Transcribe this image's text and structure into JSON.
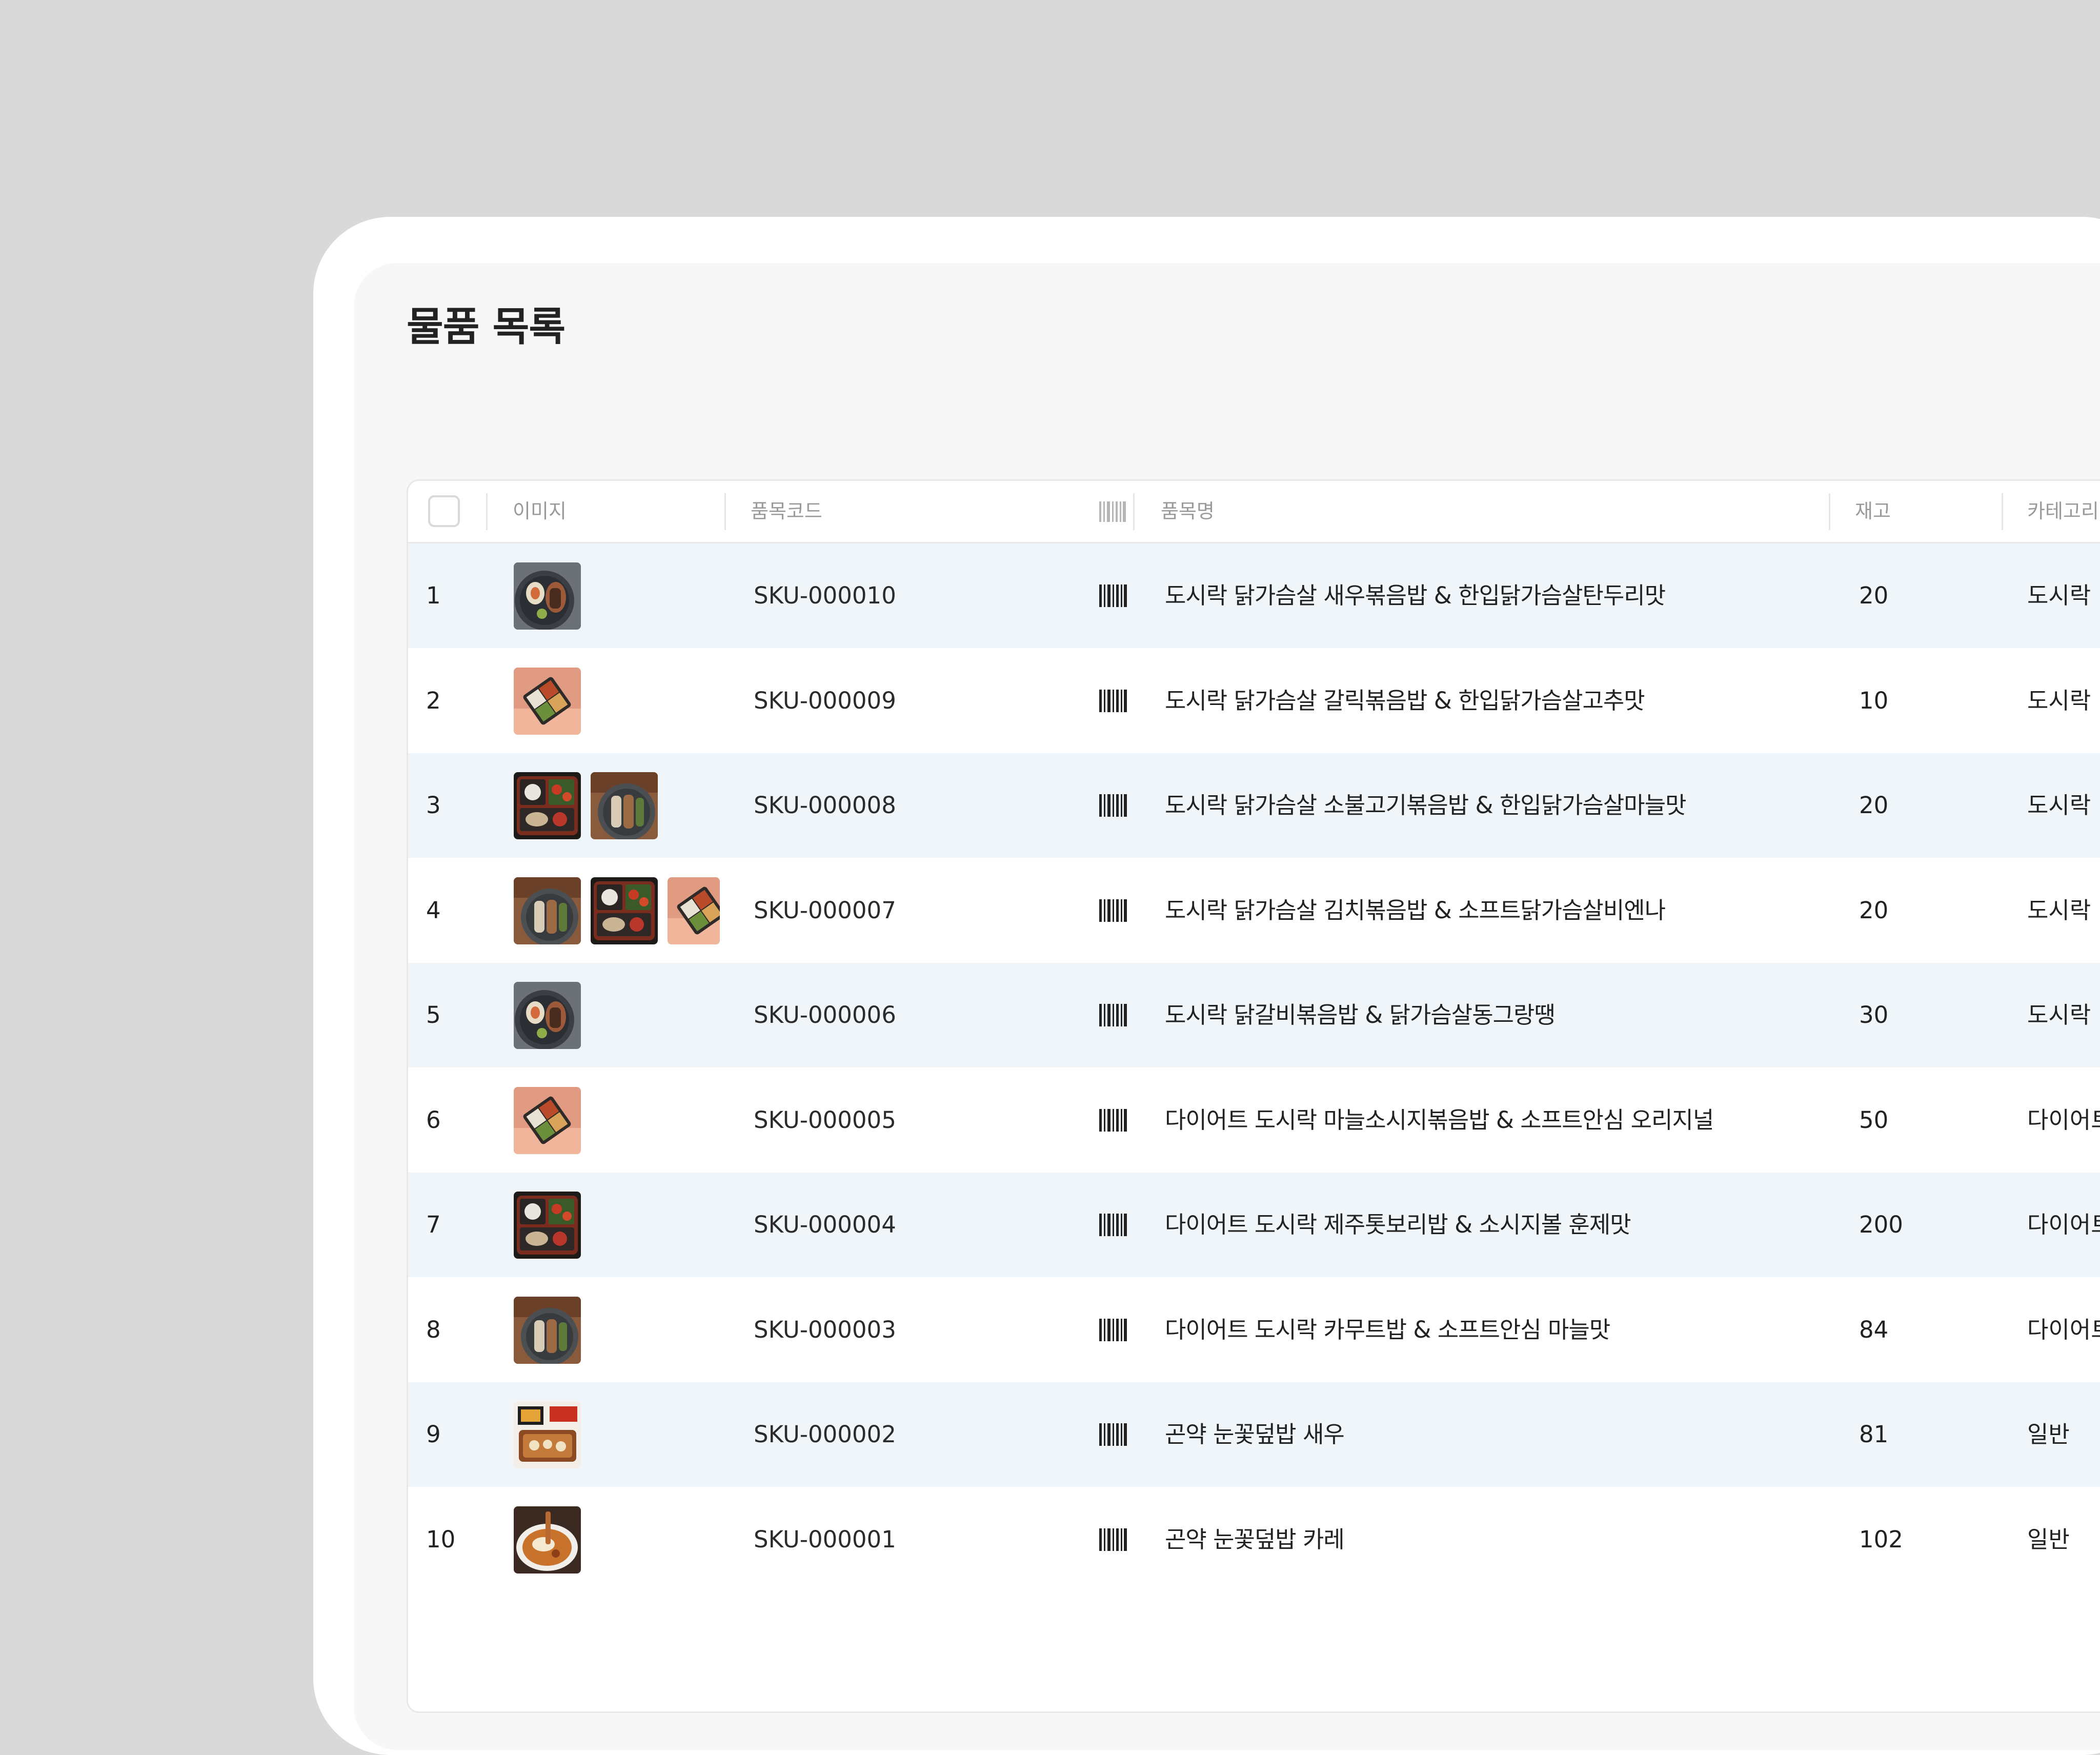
{
  "page": {
    "title": "물품 목록"
  },
  "table": {
    "headers": {
      "image": "이미지",
      "code": "품목코드",
      "name": "품목명",
      "stock": "재고",
      "category": "카테고리"
    },
    "rows": [
      {
        "no": "1",
        "code": "SKU-000010",
        "name": "도시락 닭가슴살 새우볶음밥 & 한입닭가슴살탄두리맛",
        "stock": "20",
        "category": "도시락",
        "images": [
          "dosirak-gray"
        ]
      },
      {
        "no": "2",
        "code": "SKU-000009",
        "name": "도시락 닭가슴살 갈릭볶음밥 & 한입닭가슴살고추맛",
        "stock": "10",
        "category": "도시락",
        "images": [
          "dosirak-pink"
        ]
      },
      {
        "no": "3",
        "code": "SKU-000008",
        "name": "도시락 닭가슴살 소불고기볶음밥 & 한입닭가슴살마늘맛",
        "stock": "20",
        "category": "도시락",
        "images": [
          "dosirak-dark",
          "dosirak-brown"
        ]
      },
      {
        "no": "4",
        "code": "SKU-000007",
        "name": "도시락 닭가슴살 김치볶음밥 & 소프트닭가슴살비엔나",
        "stock": "20",
        "category": "도시락",
        "images": [
          "dosirak-brown",
          "dosirak-dark",
          "dosirak-pink"
        ]
      },
      {
        "no": "5",
        "code": "SKU-000006",
        "name": "도시락 닭갈비볶음밥 & 닭가슴살동그랑땡",
        "stock": "30",
        "category": "도시락",
        "images": [
          "dosirak-gray"
        ]
      },
      {
        "no": "6",
        "code": "SKU-000005",
        "name": "다이어트 도시락 마늘소시지볶음밥 & 소프트안심 오리지널",
        "stock": "50",
        "category": "다이어트",
        "images": [
          "dosirak-pink"
        ]
      },
      {
        "no": "7",
        "code": "SKU-000004",
        "name": "다이어트 도시락 제주톳보리밥 & 소시지볼 훈제맛",
        "stock": "200",
        "category": "다이어트",
        "images": [
          "dosirak-dark"
        ]
      },
      {
        "no": "8",
        "code": "SKU-000003",
        "name": "다이어트 도시락 카무트밥 & 소프트안심 마늘맛",
        "stock": "84",
        "category": "다이어트",
        "images": [
          "dosirak-brown"
        ]
      },
      {
        "no": "9",
        "code": "SKU-000002",
        "name": "곤약 눈꽃덮밥 새우",
        "stock": "81",
        "category": "일반",
        "images": [
          "deopbap-box"
        ]
      },
      {
        "no": "10",
        "code": "SKU-000001",
        "name": "곤약 눈꽃덮밥 카레",
        "stock": "102",
        "category": "일반",
        "images": [
          "curry-plate"
        ]
      }
    ]
  },
  "icons": {
    "barcode": "barcode-icon"
  },
  "colors": {
    "row_alt": "#eff5f8",
    "header_text": "#9a9a9a",
    "text": "#222222"
  }
}
